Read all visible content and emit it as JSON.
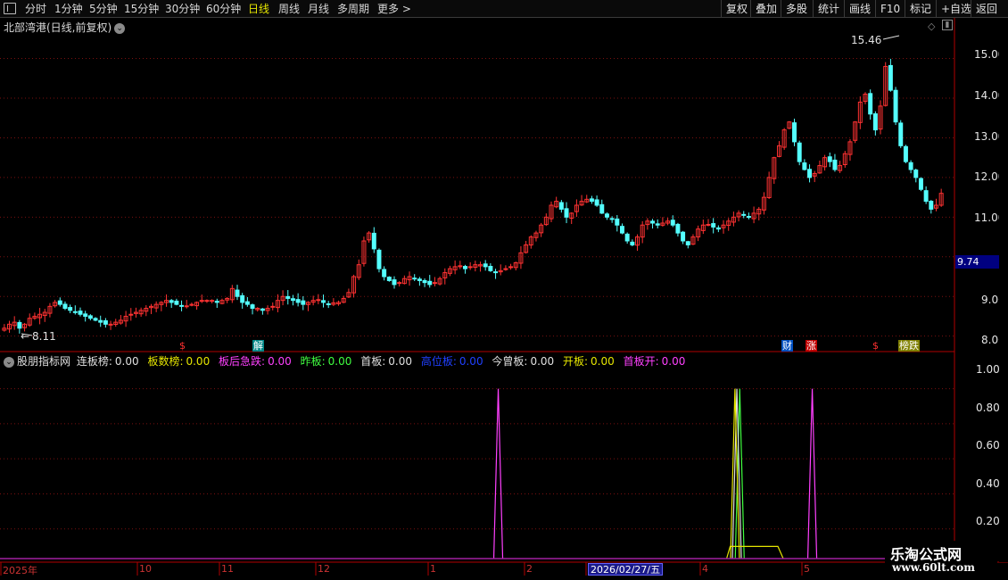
{
  "toolbar": {
    "periods": [
      "分时",
      "1分钟",
      "5分钟",
      "15分钟",
      "30分钟",
      "60分钟",
      "日线",
      "周线",
      "月线",
      "多周期",
      "更多 >"
    ],
    "active_period": "日线",
    "buttons": [
      "复权",
      "叠加",
      "多股",
      "统计",
      "画线",
      "F10",
      "标记",
      "+自选",
      "返回"
    ]
  },
  "price_panel": {
    "title": "北部湾港(日线,前复权)",
    "high_annotation": "15.46",
    "low_annotation": "8.11",
    "current_price": "9.74",
    "y_ticks": [
      "15.00",
      "14.00",
      "13.00",
      "12.00",
      "11.00",
      "9.00",
      "8.00"
    ],
    "markers": [
      {
        "text": "$",
        "color": "#ff3030",
        "bg": "#000000"
      },
      {
        "text": "解",
        "color": "#ffffff",
        "bg": "#008888"
      },
      {
        "text": "财",
        "color": "#ffffff",
        "bg": "#0050c0"
      },
      {
        "text": "涨",
        "color": "#ffffff",
        "bg": "#c00000"
      },
      {
        "text": "$",
        "color": "#ff3030",
        "bg": "#000000"
      },
      {
        "text": "榜跌",
        "color": "#ffffff",
        "bg": "#808000"
      }
    ]
  },
  "indicator_panel": {
    "name": "股朋指标网",
    "items": [
      {
        "label": "连板榜:",
        "value": "0.00",
        "color": "#e0e0e0"
      },
      {
        "label": "板数榜:",
        "value": "0.00",
        "color": "#e6e600"
      },
      {
        "label": "板后急跌:",
        "value": "0.00",
        "color": "#ff40ff"
      },
      {
        "label": "昨板:",
        "value": "0.00",
        "color": "#40ff40"
      },
      {
        "label": "首板:",
        "value": "0.00",
        "color": "#e0e0e0"
      },
      {
        "label": "高位板:",
        "value": "0.00",
        "color": "#2040ff"
      },
      {
        "label": "今曾板:",
        "value": "0.00",
        "color": "#e0e0e0"
      },
      {
        "label": "开板:",
        "value": "0.00",
        "color": "#e6e600"
      },
      {
        "label": "首板开:",
        "value": "0.00",
        "color": "#ff40ff"
      }
    ],
    "y_ticks": [
      "1.00",
      "0.80",
      "0.60",
      "0.40",
      "0.20"
    ]
  },
  "x_axis": {
    "labels": [
      "2025年",
      "10",
      "11",
      "12",
      "1",
      "2",
      "4",
      "5"
    ],
    "current_date": "2026/02/27/五"
  },
  "watermark": {
    "title": "乐淘公式网",
    "url": "www.60lt.com"
  },
  "chart_data": {
    "type": "candlestick",
    "y_price_range": [
      7.7,
      15.8
    ],
    "y_indicator_range": [
      0,
      1.1
    ],
    "price_path": [
      8.2,
      8.3,
      8.35,
      8.2,
      8.3,
      8.45,
      8.5,
      8.55,
      8.6,
      8.75,
      8.85,
      8.8,
      8.7,
      8.65,
      8.6,
      8.55,
      8.5,
      8.45,
      8.4,
      8.35,
      8.3,
      8.3,
      8.35,
      8.4,
      8.5,
      8.55,
      8.6,
      8.65,
      8.7,
      8.75,
      8.8,
      8.85,
      8.9,
      8.85,
      8.8,
      8.75,
      8.75,
      8.8,
      8.85,
      8.9,
      8.9,
      8.9,
      8.85,
      8.9,
      8.95,
      9.2,
      9.0,
      8.85,
      8.8,
      8.7,
      8.7,
      8.65,
      8.7,
      8.75,
      8.9,
      9.0,
      8.95,
      8.9,
      8.85,
      8.8,
      8.85,
      8.9,
      8.9,
      8.85,
      8.8,
      8.8,
      8.85,
      8.95,
      9.1,
      9.5,
      9.8,
      10.4,
      10.6,
      10.2,
      9.7,
      9.5,
      9.4,
      9.3,
      9.35,
      9.45,
      9.5,
      9.45,
      9.4,
      9.35,
      9.3,
      9.35,
      9.45,
      9.6,
      9.7,
      9.75,
      9.75,
      9.7,
      9.75,
      9.8,
      9.8,
      9.75,
      9.65,
      9.6,
      9.65,
      9.7,
      9.75,
      9.85,
      10.1,
      10.3,
      10.5,
      10.6,
      10.8,
      11.0,
      11.3,
      11.4,
      11.2,
      11.0,
      11.1,
      11.3,
      11.4,
      11.45,
      11.4,
      11.3,
      11.1,
      11.0,
      10.95,
      10.8,
      10.6,
      10.4,
      10.3,
      10.5,
      10.8,
      10.9,
      10.85,
      10.8,
      10.85,
      10.9,
      10.8,
      10.6,
      10.4,
      10.3,
      10.5,
      10.7,
      10.8,
      10.8,
      10.75,
      10.7,
      10.8,
      10.9,
      11.0,
      11.1,
      11.05,
      11.0,
      11.1,
      11.2,
      11.5,
      12.0,
      12.5,
      12.8,
      13.2,
      13.4,
      12.9,
      12.4,
      12.2,
      12.0,
      12.1,
      12.3,
      12.5,
      12.4,
      12.2,
      12.3,
      12.6,
      12.9,
      13.4,
      13.9,
      14.1,
      13.6,
      13.2,
      13.8,
      14.8,
      14.2,
      13.4,
      12.8,
      12.4,
      12.2,
      12.0,
      11.7,
      11.4,
      11.2,
      11.3,
      11.6
    ],
    "series": [
      {
        "name": "板后急跌",
        "color": "#ff40ff",
        "spikes": [
          {
            "x": 0.522,
            "y": 1.0
          },
          {
            "x": 0.851,
            "y": 1.0
          }
        ]
      },
      {
        "name": "昨板",
        "color": "#40ff40",
        "spikes": [
          {
            "x": 0.775,
            "y": 1.0
          }
        ]
      },
      {
        "name": "首板",
        "color": "#e0e0e0",
        "spikes": [
          {
            "x": 0.772,
            "y": 1.0
          }
        ]
      },
      {
        "name": "开板",
        "color": "#e6e600",
        "spikes": [
          {
            "x": 0.77,
            "y": 1.0
          }
        ],
        "plateau": [
          {
            "x0": 0.765,
            "x1": 0.815,
            "y": 0.1
          }
        ]
      }
    ]
  }
}
